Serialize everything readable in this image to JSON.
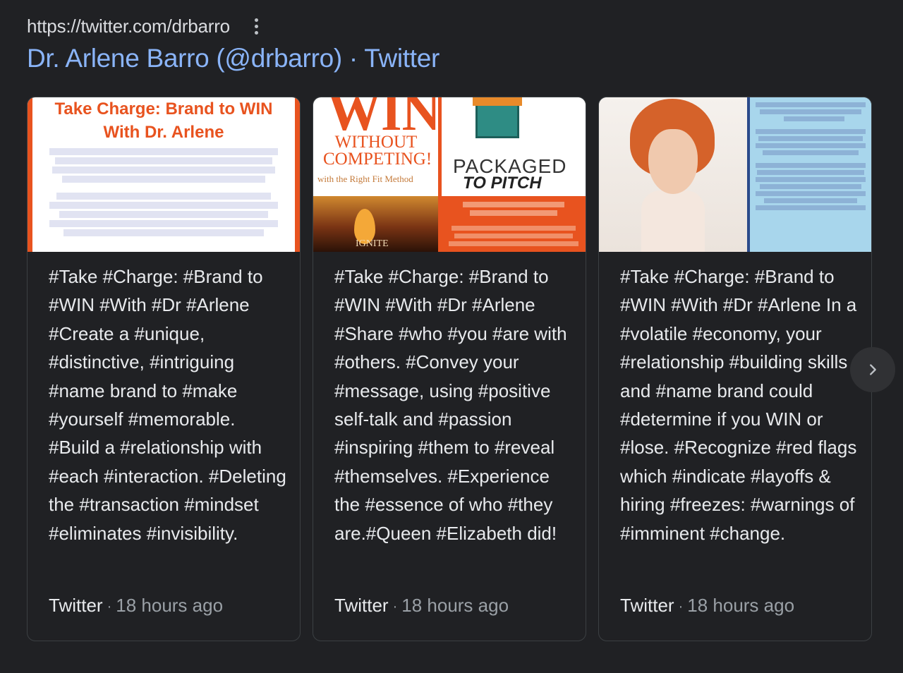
{
  "header": {
    "url": "https://twitter.com/drbarro",
    "title": "Dr. Arlene Barro (@drbarro) · Twitter"
  },
  "cards": [
    {
      "text": "#Take #Charge: #Brand to #WIN #With #Dr #Arlene #Create a #unique, #distinctive, #intriguing #name brand to #make #yourself #memorable. #Build a #relationship with #each #interaction. #Deleting the #transaction #mindset #eliminates #invisibility.",
      "source": "Twitter",
      "time": "18 hours ago",
      "thumb": {
        "line1": "Take Charge: Brand to WIN",
        "line2": "With Dr. Arlene"
      }
    },
    {
      "text": "#Take #Charge: #Brand to #WIN #With #Dr #Arlene #Share #who #you #are with #others. #Convey your #message, using #positive self-talk and #passion #inspiring #them to #reveal #themselves. #Experience the #essence of who #they are.#Queen #Elizabeth did!",
      "source": "Twitter",
      "time": "18 hours ago",
      "thumb": {
        "win": "WIN",
        "without": "WITHOUT COMPETING!",
        "right_fit": "with the Right Fit Method",
        "packaged": "PACKAGED",
        "pitch": "TO PITCH",
        "ignite": "IGNITE"
      }
    },
    {
      "text": "#Take #Charge: #Brand to #WIN #With #Dr #Arlene In a #volatile #economy, your #relationship #building skills and #name brand could #determine if you WIN or #lose. #Recognize #red flags which #indicate #layoffs & hiring #freezes: #warnings of #imminent #change.",
      "source": "Twitter",
      "time": "18 hours ago",
      "thumb": {}
    }
  ],
  "icons": {
    "more": "kebab-icon",
    "next": "chevron-right-icon"
  }
}
